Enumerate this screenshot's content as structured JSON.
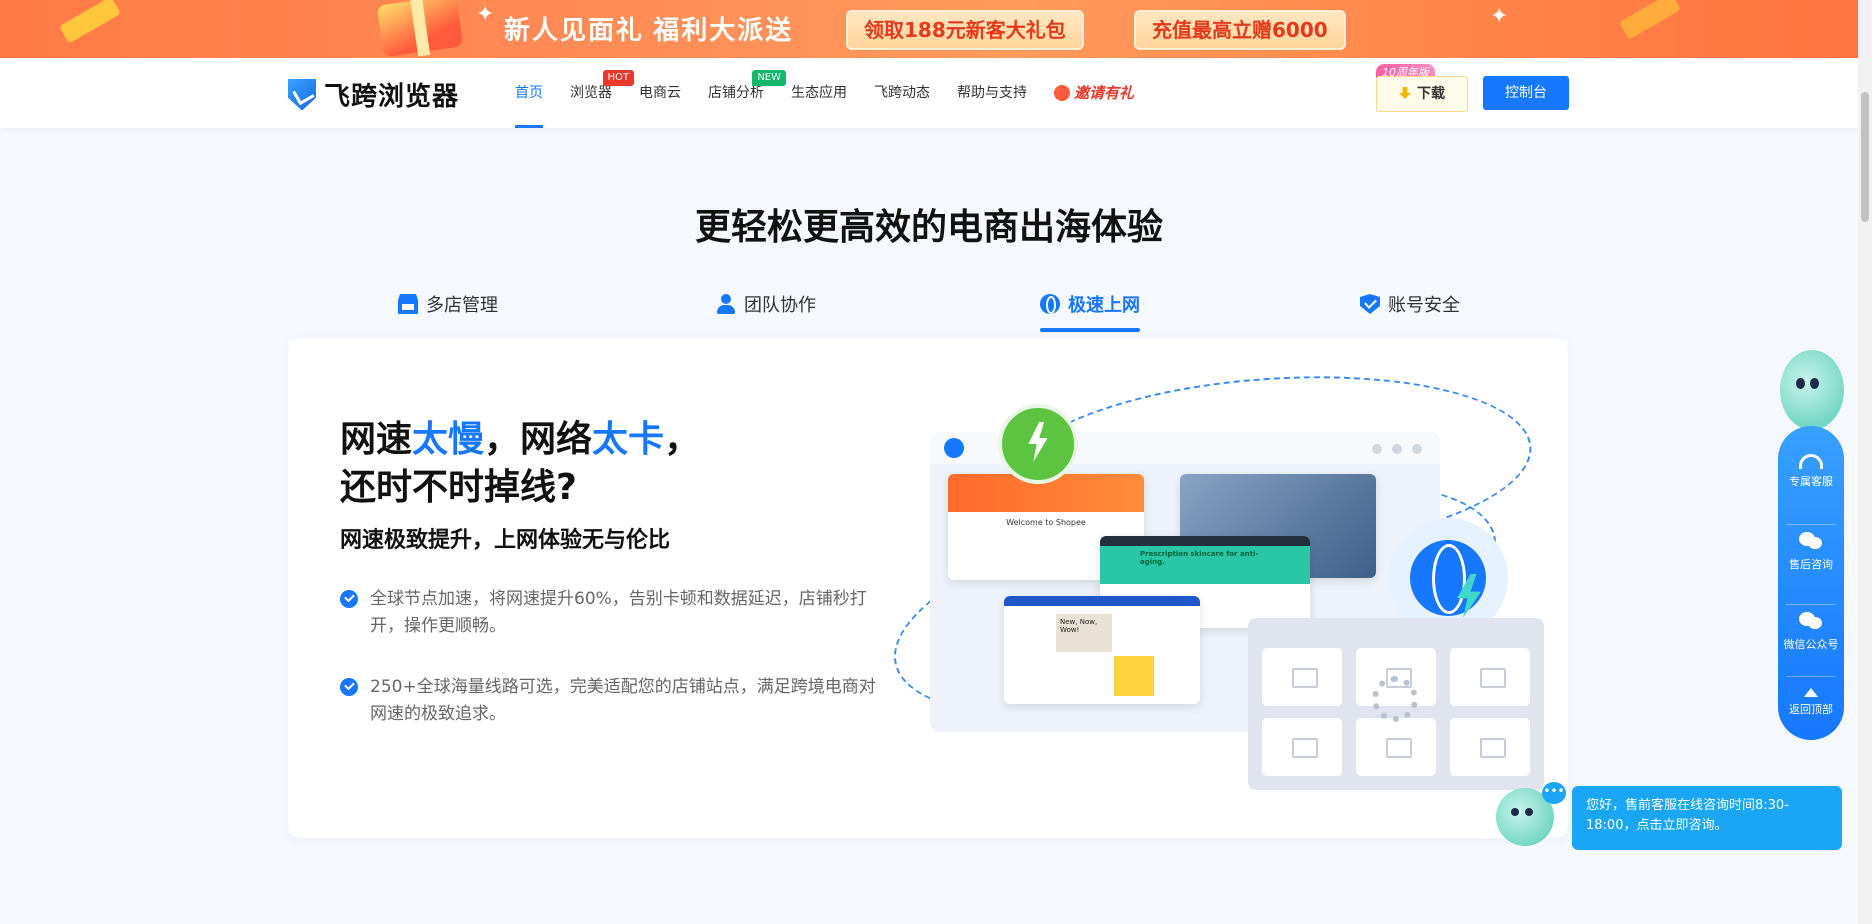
{
  "banner": {
    "title": "新人见面礼  福利大派送",
    "pill1": "领取188元新客大礼包",
    "pill2": "充值最高立赠6000"
  },
  "nav": {
    "logo": "飞跨浏览器",
    "items": [
      {
        "label": "首页",
        "tag": ""
      },
      {
        "label": "浏览器",
        "tag": "HOT"
      },
      {
        "label": "电商云",
        "tag": ""
      },
      {
        "label": "店铺分析",
        "tag": "NEW"
      },
      {
        "label": "生态应用",
        "tag": ""
      },
      {
        "label": "飞跨动态",
        "tag": ""
      },
      {
        "label": "帮助与支持",
        "tag": ""
      }
    ],
    "invite": "邀请有礼",
    "download_badge": "10周年版",
    "download": "下载",
    "console": "控制台",
    "accent": "#1677ff"
  },
  "section": {
    "title": "更轻松更高效的电商出海体验",
    "tabs": [
      "多店管理",
      "团队协作",
      "极速上网",
      "账号安全"
    ],
    "active_tab": "极速上网"
  },
  "card": {
    "headline": {
      "p1": "网速",
      "b1": "太慢",
      "p2": "，网络",
      "b2": "太卡",
      "p3": "，",
      "line2": "还时不时掉线?"
    },
    "subhead": "网速极致提升，上网体验无与伦比",
    "features": [
      "全球节点加速，将网速提升60%，告别卡顿和数据延迟，店铺秒打开，操作更顺畅。",
      "250+全球海量线路可选，完美适配您的店铺站点，满足跨境电商对网速的极致追求。"
    ],
    "shots": {
      "shopee": "Welcome to Shopee",
      "banner_text": "New, Now, Wow!",
      "amazon_text": "Prescription skincare for anti-aging."
    }
  },
  "float": {
    "items": [
      "专属客服",
      "售后咨询",
      "微信公众号",
      "返回顶部"
    ]
  },
  "chat": {
    "message": "您好，售前客服在线咨询时间8:30-18:00，点击立即咨询。"
  }
}
